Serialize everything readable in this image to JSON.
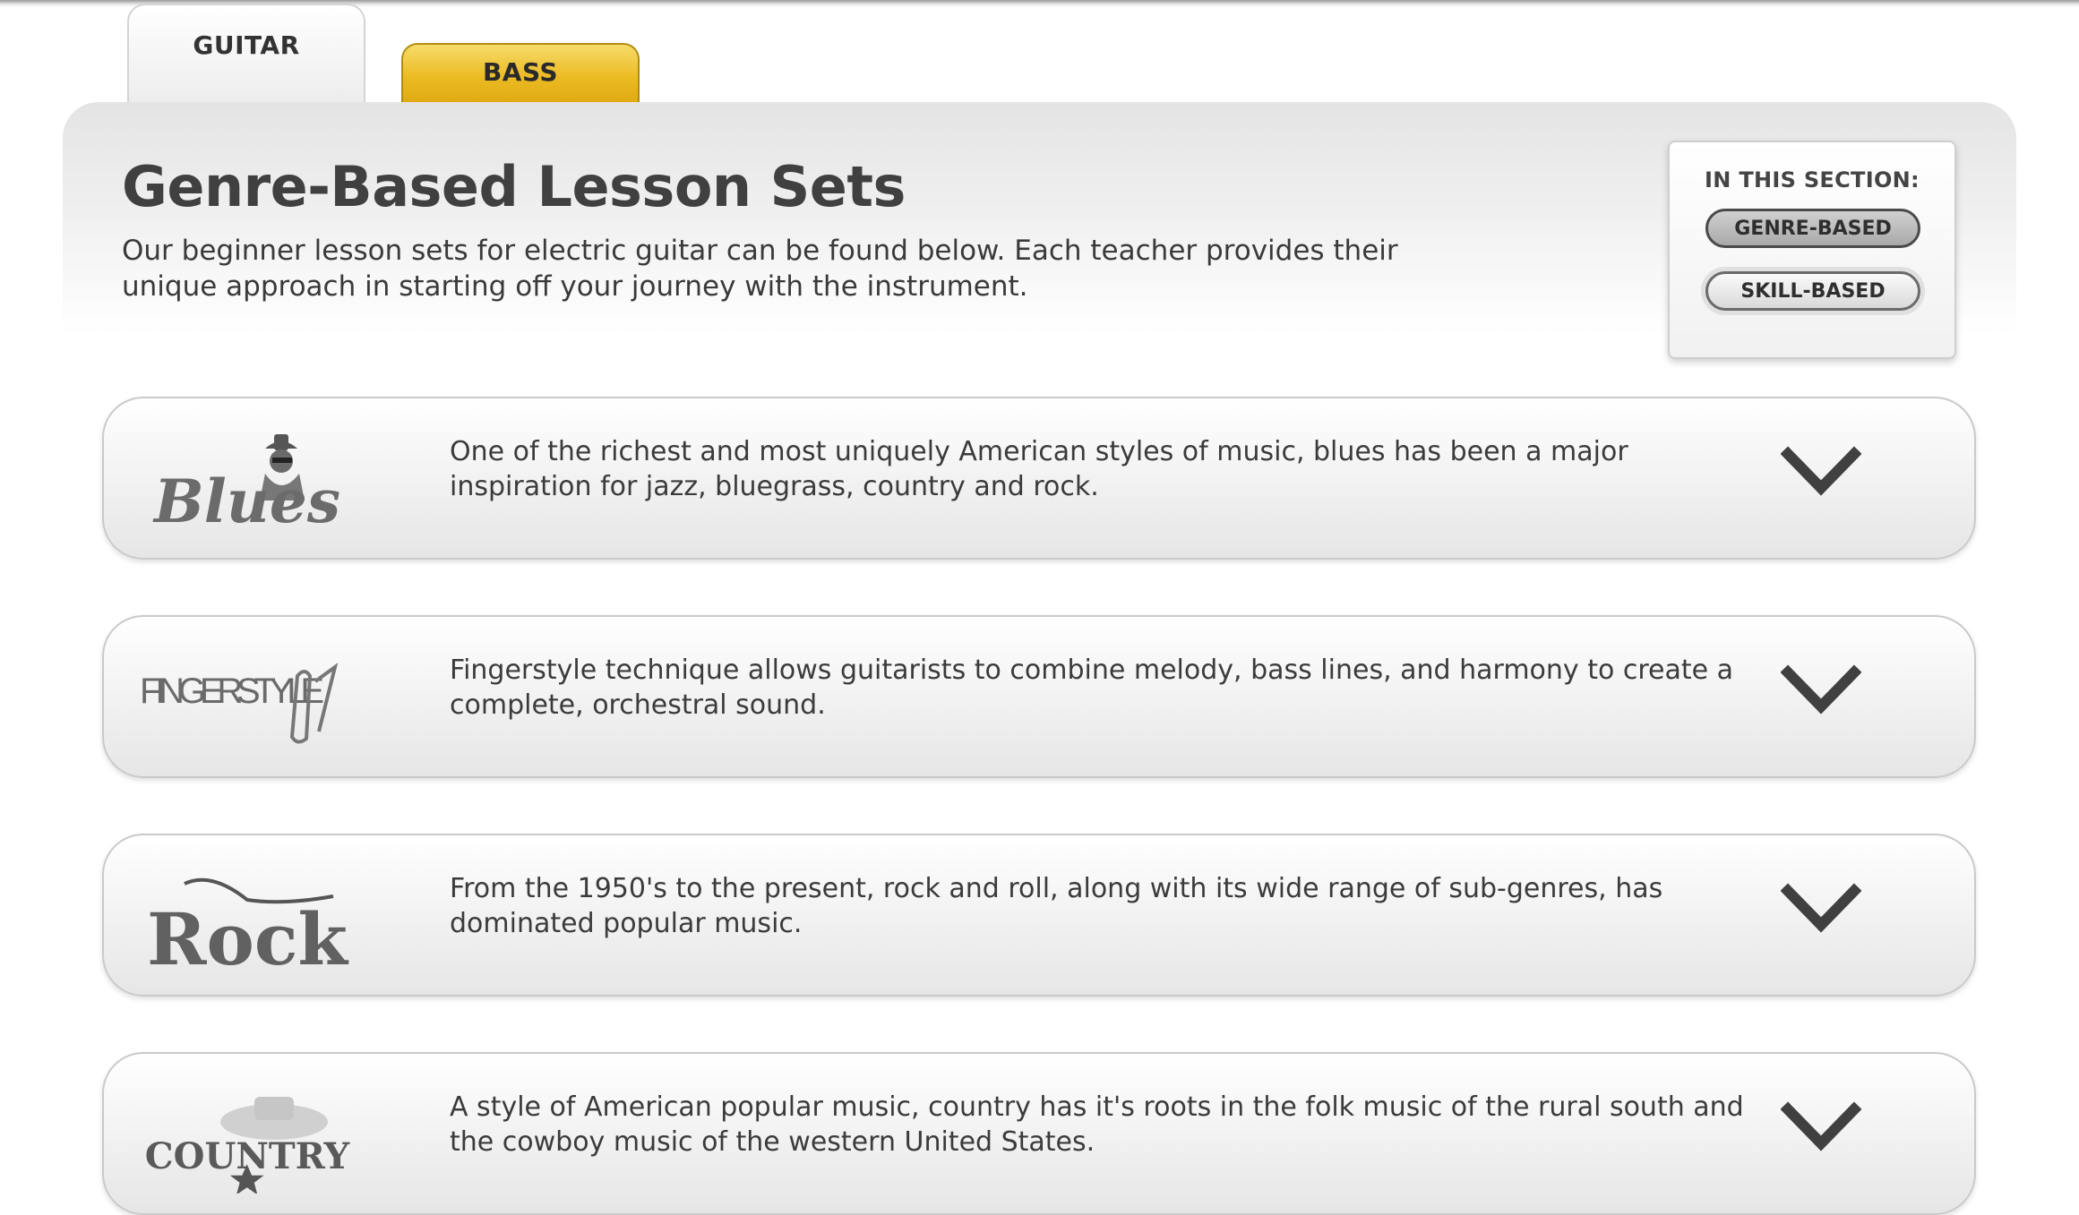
{
  "tabs": [
    {
      "label": "GUITAR",
      "active": true
    },
    {
      "label": "BASS",
      "active": false
    }
  ],
  "header": {
    "title": "Genre-Based Lesson Sets",
    "description": "Our beginner lesson sets for electric guitar can be found below. Each teacher provides their unique approach in starting off your journey with the instrument."
  },
  "section_nav": {
    "label": "IN THIS SECTION:",
    "items": [
      "GENRE-BASED",
      "SKILL-BASED"
    ],
    "selected": "GENRE-BASED"
  },
  "genres": [
    {
      "logo_text": "Blues",
      "description": "One of the richest and most uniquely American styles of music, blues has been a major inspiration for jazz, bluegrass, country and rock."
    },
    {
      "logo_text": "FINGERSTYLE",
      "description": "Fingerstyle technique allows guitarists to combine melody, bass lines, and harmony to create a complete, orchestral sound."
    },
    {
      "logo_text": "Rock",
      "description": "From the 1950's to the present, rock and roll, along with its wide range of sub-genres, has dominated popular music."
    },
    {
      "logo_text": "COUNTRY",
      "description": "A style of American popular music, country has it's roots in the folk music of the rural south and the cowboy music of the western United States."
    }
  ],
  "colors": {
    "bass_tab": "#ebbb23",
    "text": "#3d3d3d",
    "chevron": "#404040"
  },
  "icons": {
    "expand": "chevron-down-icon"
  }
}
